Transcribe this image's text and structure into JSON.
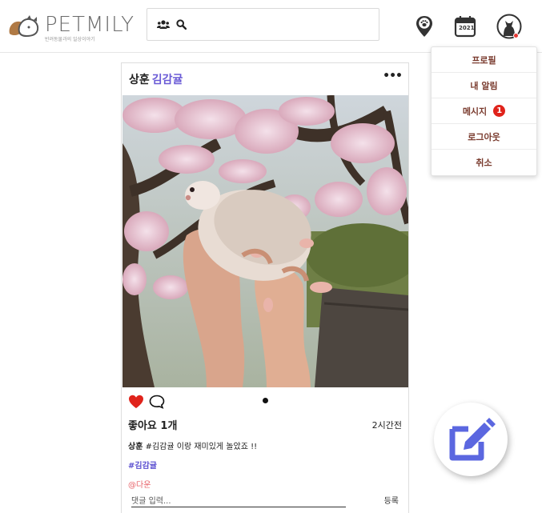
{
  "header": {
    "logo_text": "PETMILY",
    "logo_sub": "반려동물과의 일상이야기",
    "search_placeholder": "",
    "calendar_year": "2021"
  },
  "menu": {
    "items": [
      {
        "label": "프로필"
      },
      {
        "label": "내 알림"
      },
      {
        "label": "메시지",
        "badge": "1"
      },
      {
        "label": "로그아웃"
      },
      {
        "label": "취소"
      }
    ]
  },
  "post": {
    "author": "상훈",
    "pet": "김감귤",
    "more": "•••",
    "likes": "좋아요 1개",
    "time": "2시간전",
    "caption_user": "상훈",
    "caption_text": " #김감귤 이랑 재미있게 놀았죠 !!",
    "hashtag": "#김감귤",
    "mention": "@다운",
    "comment_placeholder": "댓글 입력...",
    "submit_label": "등록"
  },
  "colors": {
    "accent": "#6a5bd6",
    "menu_text": "#7a3b2e",
    "badge": "#e0231b",
    "like": "#e0231b",
    "mention": "#e8646a"
  },
  "icons": [
    "paw-icon",
    "calendar-icon",
    "avatar-icon",
    "people-icon",
    "search-icon",
    "heart-icon",
    "comment-icon",
    "edit-icon"
  ]
}
